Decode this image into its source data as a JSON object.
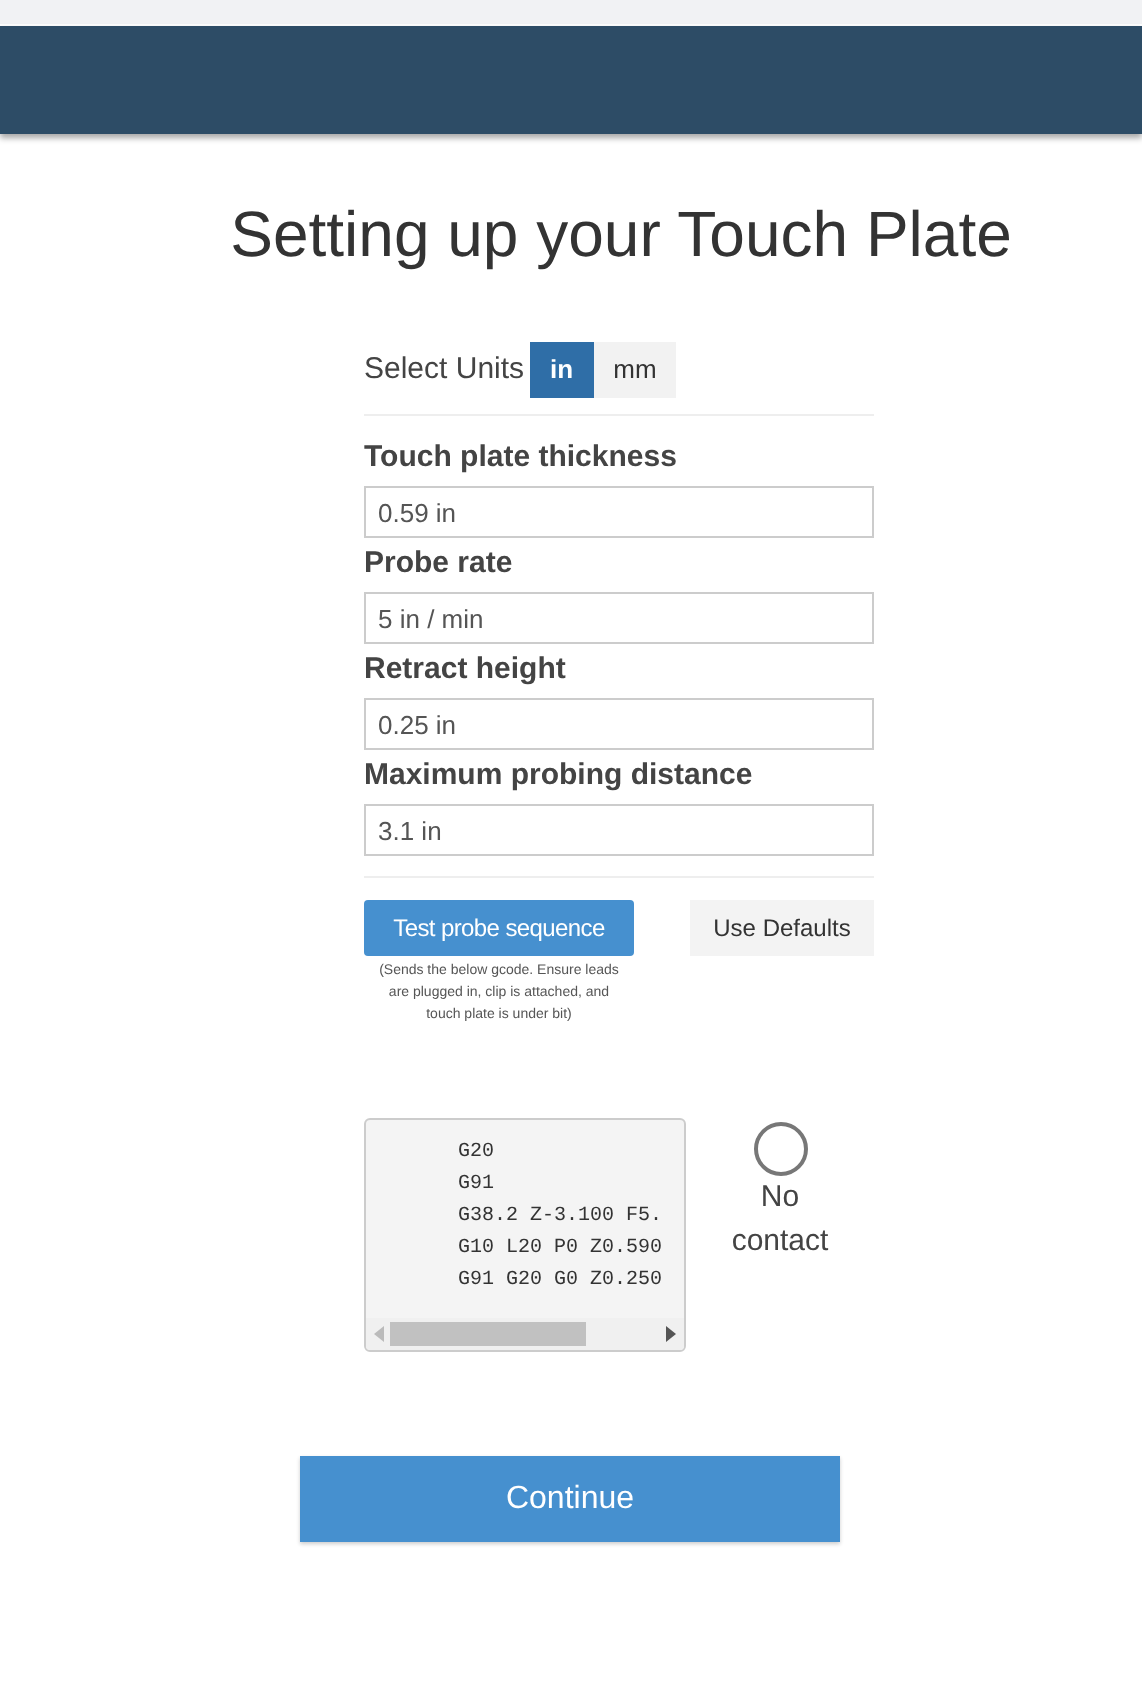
{
  "title": "Setting up your Touch Plate",
  "units": {
    "label": "Select Units",
    "options": [
      {
        "label": "in",
        "selected": true
      },
      {
        "label": "mm",
        "selected": false
      }
    ]
  },
  "fields": [
    {
      "label": "Touch plate thickness",
      "value": "0.59 in"
    },
    {
      "label": "Probe rate",
      "value": "5 in / min"
    },
    {
      "label": "Retract height",
      "value": "0.25 in"
    },
    {
      "label": "Maximum probing distance",
      "value": "3.1 in"
    }
  ],
  "test_button": "Test probe sequence",
  "test_note": "(Sends the below gcode. Ensure leads are plugged in, clip is attached, and touch plate is under bit)",
  "defaults_button": "Use Defaults",
  "gcode": [
    "G20",
    "G91",
    "G38.2 Z-3.100 F5.",
    "G10 L20 P0 Z0.590",
    "G91 G20 G0 Z0.250"
  ],
  "contact": {
    "detected": false,
    "label": "No contact"
  },
  "continue_button": "Continue"
}
